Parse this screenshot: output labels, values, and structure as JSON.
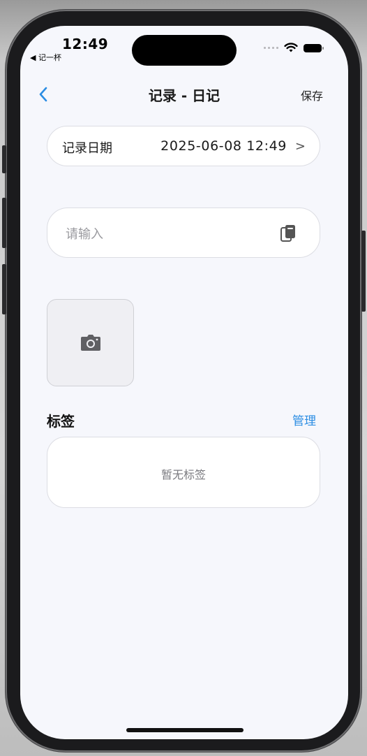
{
  "status_bar": {
    "time": "12:49",
    "back_app": "◀ 记一杯"
  },
  "nav": {
    "title": "记录 - 日记",
    "save_label": "保存"
  },
  "record_date": {
    "label": "记录日期",
    "value": "2025-06-08 12:49",
    "chevron": ">"
  },
  "note_input": {
    "placeholder": "请输入",
    "value": ""
  },
  "tags": {
    "heading": "标签",
    "manage_label": "管理",
    "empty_text": "暂无标签"
  },
  "colors": {
    "accent": "#2b8de3",
    "background": "#f6f7fc",
    "card": "#ffffff"
  },
  "icons": {
    "back": "chevron-left-icon",
    "clipboard": "clipboard-icon",
    "camera": "camera-icon",
    "wifi": "wifi-icon",
    "battery": "battery-icon"
  }
}
